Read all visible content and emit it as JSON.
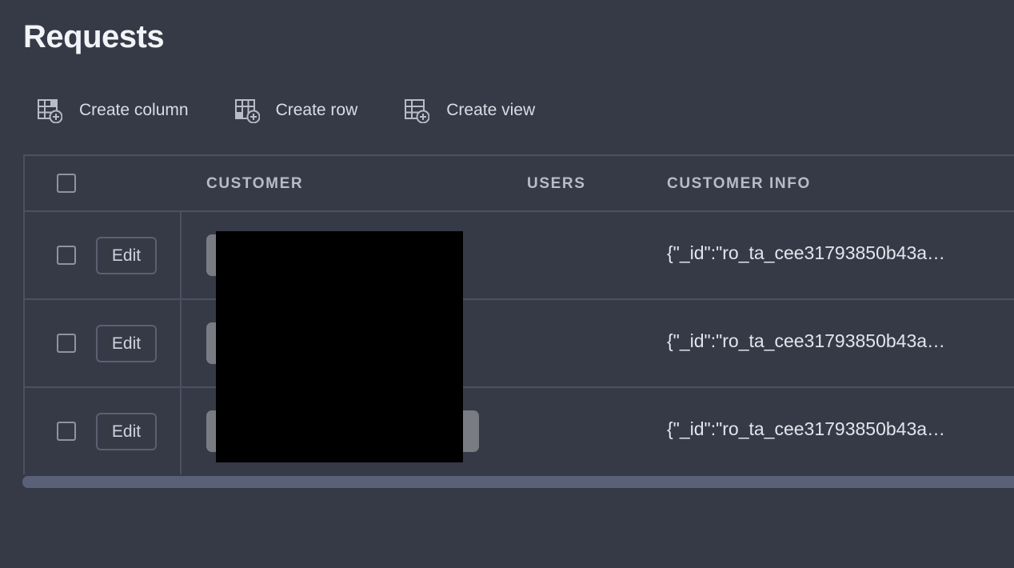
{
  "page": {
    "title": "Requests"
  },
  "toolbar": {
    "create_column": {
      "label": "Create column",
      "icon": "table-add-column-icon"
    },
    "create_row": {
      "label": "Create row",
      "icon": "table-add-row-icon"
    },
    "create_view": {
      "label": "Create view",
      "icon": "table-add-view-icon"
    }
  },
  "table": {
    "columns": [
      "CUSTOMER",
      "USERS",
      "CUSTOMER INFO"
    ],
    "edit_label": "Edit",
    "rows": [
      {
        "customer_info": "{\"_id\":\"ro_ta_cee31793850b43a…"
      },
      {
        "customer_info": "{\"_id\":\"ro_ta_cee31793850b43a…"
      },
      {
        "customer_info": "{\"_id\":\"ro_ta_cee31793850b43a…"
      }
    ]
  },
  "colors": {
    "background": "#363a47",
    "border": "#4b5061",
    "chip": "#7a7c84",
    "scrollbar": "#5a6078"
  }
}
